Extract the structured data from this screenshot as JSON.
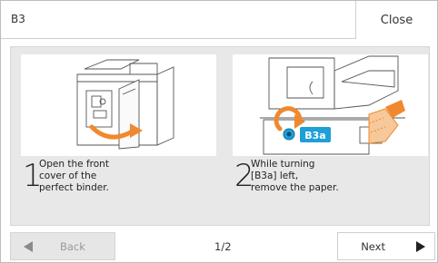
{
  "window": {
    "title": "B3",
    "close_label": "Close"
  },
  "steps": [
    {
      "number": "1",
      "text": "Open the front\ncover of the\nperfect binder."
    },
    {
      "number": "2",
      "text": "While turning\n[B3a] left,\nremove the paper."
    }
  ],
  "illustration": {
    "callout_label": "B3a",
    "accent_color": "#1e9fd6",
    "arrow_color": "#f0892e"
  },
  "nav": {
    "back_label": "Back",
    "page_indicator": "1/2",
    "next_label": "Next"
  }
}
